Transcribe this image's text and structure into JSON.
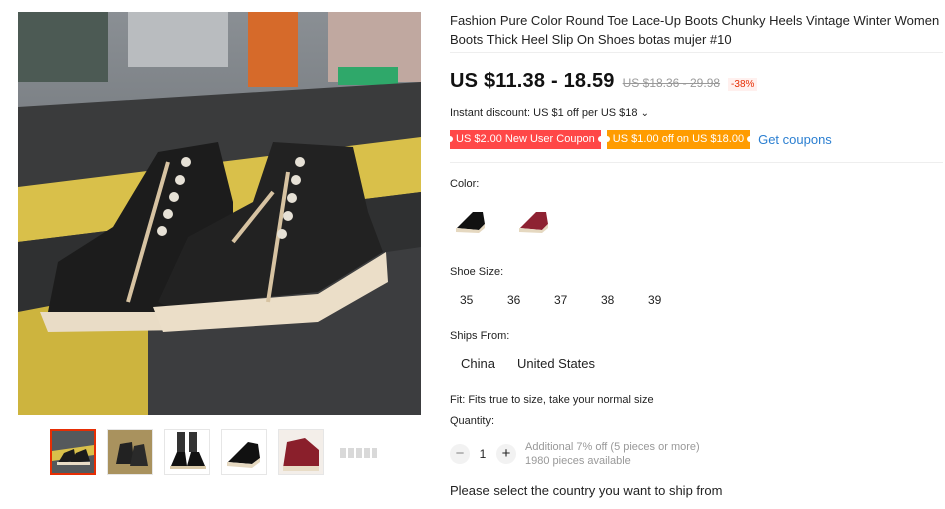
{
  "product": {
    "title": "Fashion Pure Color Round Toe Lace-Up Boots Chunky Heels Vintage Winter Women Boots Thick Heel Slip On Shoes botas mujer #10",
    "price": "US $11.38 - 18.59",
    "old_price": "US $18.36 - 29.98",
    "discount_pct": "-38%",
    "instant_discount": "Instant discount: US $1 off per US $18",
    "instant_caret": "⌄",
    "coupons": [
      {
        "label": "US $2.00 New User Coupon"
      },
      {
        "label": "US $1.00 off on US $18.00"
      }
    ],
    "get_coupons": "Get coupons",
    "color_label": "Color:",
    "size_label": "Shoe Size:",
    "sizes": [
      "35",
      "36",
      "37",
      "38",
      "39"
    ],
    "ships_label": "Ships From:",
    "ships": [
      "China",
      "United States"
    ],
    "fit": "Fit: Fits true to size, take your normal size",
    "quantity_label": "Quantity:",
    "quantity": {
      "minus": "−",
      "value": "1",
      "plus": "+",
      "discount_note": "Additional 7% off (5 pieces or more)",
      "available": "1980 pieces available"
    },
    "ship_note": "Please select the country you want to ship from"
  },
  "colors": {
    "accent": "#e62e04",
    "coupon_red": "#ff4747",
    "coupon_orange": "#ff9c00",
    "link": "#2b7fd1"
  }
}
